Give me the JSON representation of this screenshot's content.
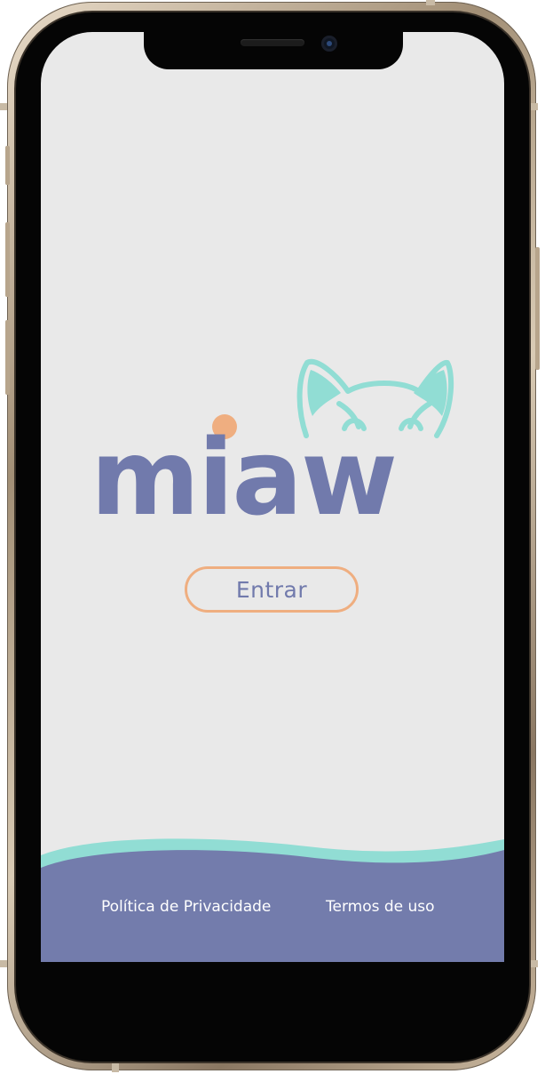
{
  "app": {
    "logo_text": "miaw",
    "colors": {
      "background": "#e9e9e9",
      "brand_purple": "#717aac",
      "mint": "#91ddd4",
      "accent_orange": "#efae80",
      "footer": "#737cac"
    }
  },
  "main": {
    "enter_label": "Entrar"
  },
  "footer": {
    "privacy_label": "Política de Privacidade",
    "terms_label": "Termos de uso"
  },
  "icons": {
    "cat_ears": "cat-ears-icon",
    "dot": "orange-dot-icon"
  }
}
